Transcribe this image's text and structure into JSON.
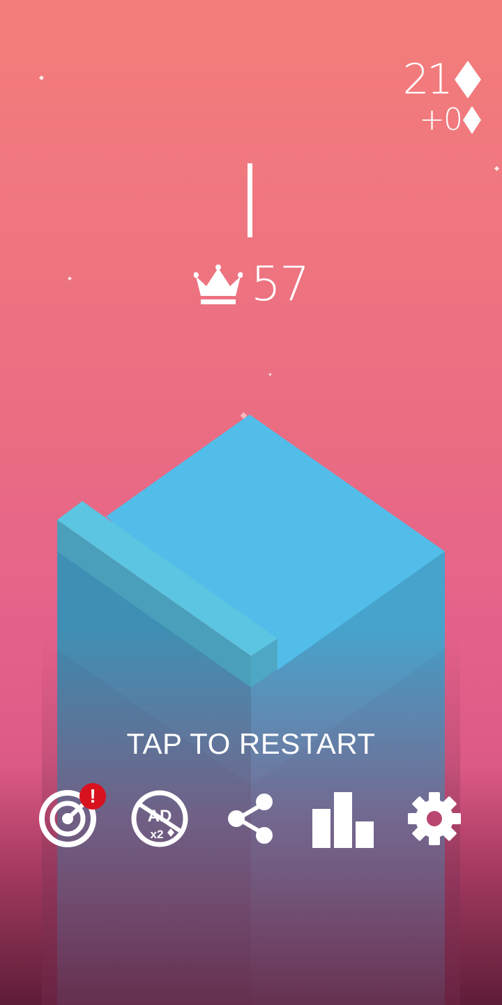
{
  "hud": {
    "gem_total": "21",
    "gem_bonus": "+0",
    "best_score": "57"
  },
  "restart_prompt": "TAP TO RESTART",
  "buttons": {
    "missions": {
      "icon": "target-icon",
      "badge": "!"
    },
    "no_ads": {
      "icon": "ad-x2-icon",
      "label_top": "AD",
      "label_bottom": "x2"
    },
    "share": {
      "icon": "share-icon"
    },
    "leaderboard": {
      "icon": "leaderboard-icon"
    },
    "settings": {
      "icon": "gear-icon"
    }
  },
  "colors": {
    "badge": "#d9121f",
    "block_top": "#52bde9",
    "block_left": "#3f8fb4",
    "block_right": "#45a2cc"
  }
}
